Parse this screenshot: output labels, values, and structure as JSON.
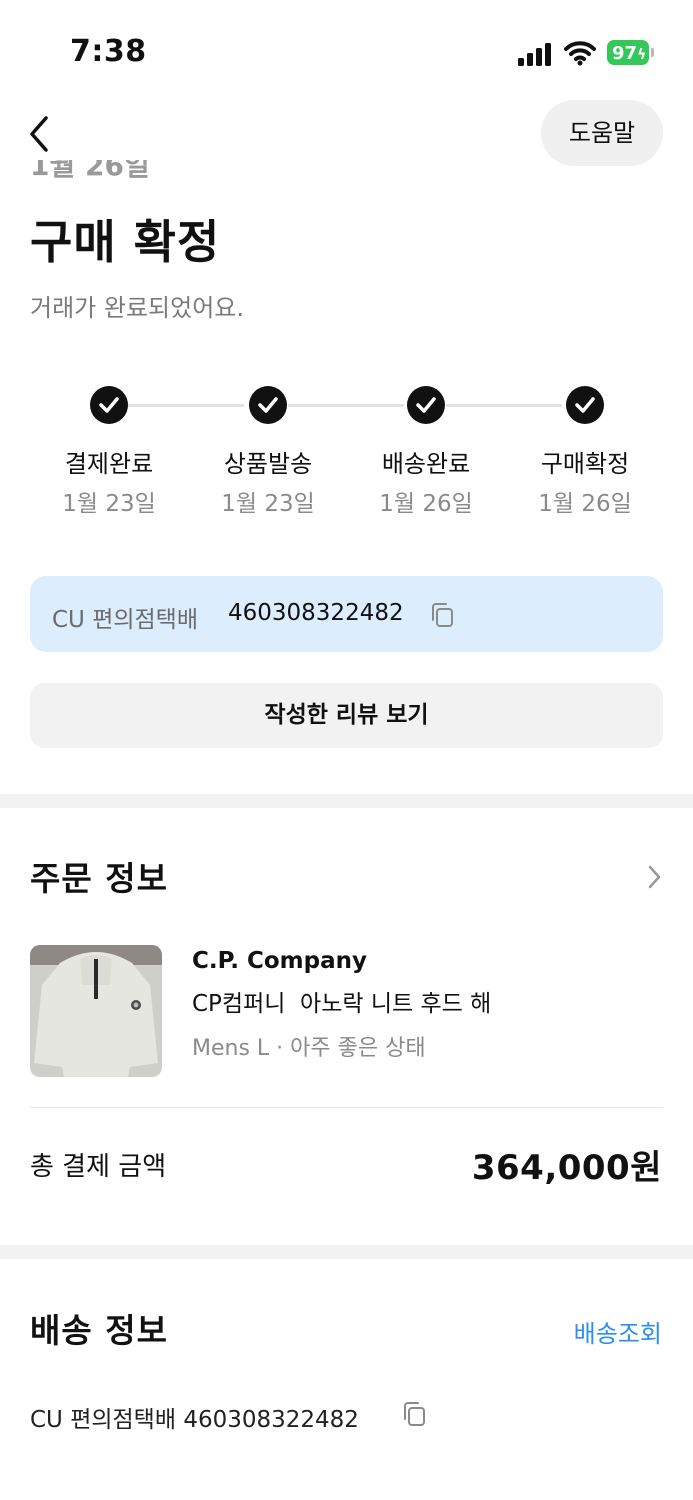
{
  "status_bar": {
    "time": "7:38",
    "battery_level": "97",
    "icons": [
      "cellular-signal-icon",
      "wifi-icon",
      "battery-charging-icon"
    ]
  },
  "header": {
    "back_icon": "chevron-left-icon",
    "help_label": "도움말"
  },
  "order_status": {
    "clipped_date": "1월 26일",
    "title": "구매 확정",
    "subtitle": "거래가 완료되었어요.",
    "steps": [
      {
        "label": "결제완료",
        "date": "1월 23일",
        "done": true
      },
      {
        "label": "상품발송",
        "date": "1월 23일",
        "done": true
      },
      {
        "label": "배송완료",
        "date": "1월 26일",
        "done": true
      },
      {
        "label": "구매확정",
        "date": "1월 26일",
        "done": true
      }
    ]
  },
  "tracking": {
    "carrier": "CU 편의점택배",
    "number": "460308322482",
    "copy_icon": "copy-icon"
  },
  "review_button_label": "작성한 리뷰 보기",
  "order_info": {
    "title": "주문 정보",
    "chevron_icon": "chevron-right-icon",
    "product": {
      "brand": "C.P. Company",
      "name": "CP컴퍼니  아노락 니트 후드 해",
      "meta": "Mens L · 아주 좋은 상태"
    },
    "total_label": "총 결제 금액",
    "total_value": "364,000원"
  },
  "shipping_info": {
    "title": "배송 정보",
    "track_link": "배송조회",
    "line": "CU 편의점택배 460308322482"
  },
  "colors": {
    "accent_blue": "#2b8ef0",
    "tracking_bg": "#dcedfe",
    "battery_green": "#34c759"
  }
}
